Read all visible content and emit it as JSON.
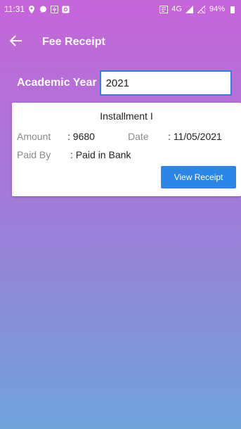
{
  "status_bar": {
    "time": "11:31",
    "network": "4G",
    "battery": "94%",
    "icons": [
      "location-icon",
      "chat-icon",
      "usb-icon",
      "notification-icon",
      "data-icon",
      "signal-icon",
      "no-signal-icon",
      "battery-icon"
    ]
  },
  "toolbar": {
    "title": "Fee Receipt",
    "back_icon": "arrow-left-icon"
  },
  "filter": {
    "label": "Academic Year",
    "value": "2021"
  },
  "receipt": {
    "title": "Installment I",
    "amount_label": "Amount",
    "amount_value": ": 9680",
    "date_label": "Date",
    "date_value": ": 11/05/2021",
    "paid_by_label": "Paid By",
    "paid_by_value": ": Paid in Bank",
    "button_label": "View Receipt"
  },
  "colors": {
    "gradient_top": "#C665D9",
    "gradient_bottom": "#6FA3DC",
    "accent": "#2C86E8",
    "input_border": "#2F7FE0"
  }
}
